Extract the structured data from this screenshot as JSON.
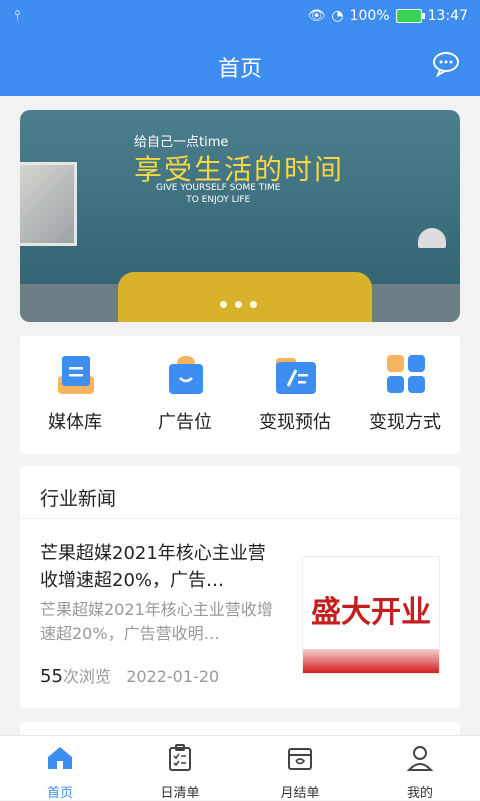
{
  "status_bar": {
    "battery": "100%",
    "time": "13:47"
  },
  "header": {
    "title": "首页"
  },
  "banner": {
    "line1": "给自己一点time",
    "line2": "享受生活的时间",
    "line3a": "GIVE YOURSELF SOME TIME",
    "line3b": "TO ENJOY LIFE"
  },
  "menu": [
    {
      "label": "媒体库",
      "icon": "media-library-icon"
    },
    {
      "label": "广告位",
      "icon": "ad-slot-icon"
    },
    {
      "label": "变现预估",
      "icon": "revenue-estimate-icon"
    },
    {
      "label": "变现方式",
      "icon": "monetization-method-icon"
    }
  ],
  "news": {
    "title": "行业新闻",
    "article": {
      "title": "芒果超媒2021年核心主业营收增速超20%，广告…",
      "desc": "芒果超媒2021年核心主业营收增速超20%，广告营收明…",
      "views": "55",
      "views_suffix": "次浏览",
      "date": "2022-01-20",
      "image_text": "盛大开业"
    }
  },
  "tabbar": [
    {
      "label": "首页",
      "active": true
    },
    {
      "label": "日清单"
    },
    {
      "label": "月结单"
    },
    {
      "label": "我的"
    }
  ],
  "colors": {
    "primary": "#3d8ef0"
  }
}
